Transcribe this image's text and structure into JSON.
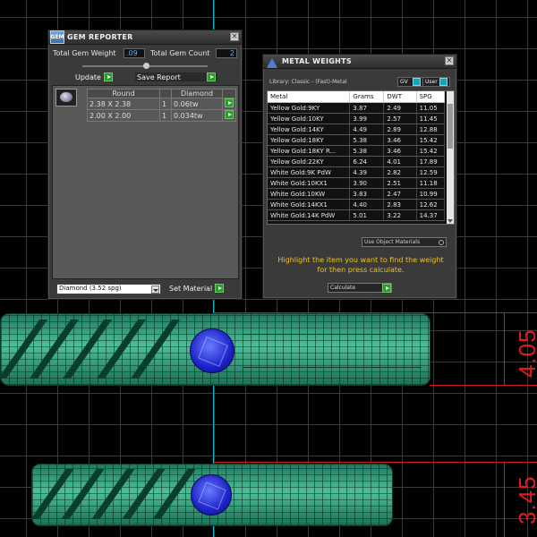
{
  "viewport": {
    "dimensions": [
      "4.05",
      "3.45"
    ]
  },
  "gem_reporter": {
    "title": "GEM REPORTER",
    "icon_text": "GEM",
    "total_weight_label": "Total Gem Weight",
    "total_weight_value": ".09",
    "total_count_label": "Total Gem Count",
    "total_count_value": "2",
    "update_label": "Update",
    "save_report_label": "Save Report",
    "table": {
      "headers": [
        "Round",
        "",
        "Diamond"
      ],
      "rows": [
        [
          "2.38 X 2.38",
          "1",
          "0.06tw"
        ],
        [
          "2.00 X 2.00",
          "1",
          "0.034tw"
        ]
      ]
    },
    "material_select": "Diamond     (3.52 spg)",
    "set_material_label": "Set Material"
  },
  "metal_weights": {
    "title": "METAL WEIGHTS",
    "library_label": "Library: Classic - (Fast)-Metal",
    "gv_label": "GV",
    "user_label": "User",
    "columns": [
      "Metal",
      "Grams",
      "DWT",
      "SPG"
    ],
    "rows": [
      [
        "Yellow Gold:9KY",
        "3.87",
        "2.49",
        "11.05"
      ],
      [
        "Yellow Gold:10KY",
        "3.99",
        "2.57",
        "11.45"
      ],
      [
        "Yellow Gold:14KY",
        "4.49",
        "2.89",
        "12.88"
      ],
      [
        "Yellow Gold:18KY",
        "5.38",
        "3.46",
        "15.42"
      ],
      [
        "Yellow Gold:18KY R...",
        "5.38",
        "3.46",
        "15.42"
      ],
      [
        "Yellow Gold:22KY",
        "6.24",
        "4.01",
        "17.89"
      ],
      [
        "White Gold:9K PdW",
        "4.39",
        "2.82",
        "12.59"
      ],
      [
        "White Gold:10KX1",
        "3.90",
        "2.51",
        "11.18"
      ],
      [
        "White Gold:10KW",
        "3.83",
        "2.47",
        "10.99"
      ],
      [
        "White Gold:14KX1",
        "4.40",
        "2.83",
        "12.62"
      ],
      [
        "White Gold:14K PdW",
        "5.01",
        "3.22",
        "14.37"
      ]
    ],
    "use_object_materials_label": "Use Object Materials",
    "hint": "Highlight the item you want to find the weight for then press calculate.",
    "calculate_label": "Calculate"
  },
  "colors": {
    "accent_teal": "#1ab3c8",
    "dimension_red": "#e31b1b",
    "hint_yellow": "#f2c21b",
    "gem_blue": "#1b22c8",
    "ring_green": "#2e9a77"
  }
}
